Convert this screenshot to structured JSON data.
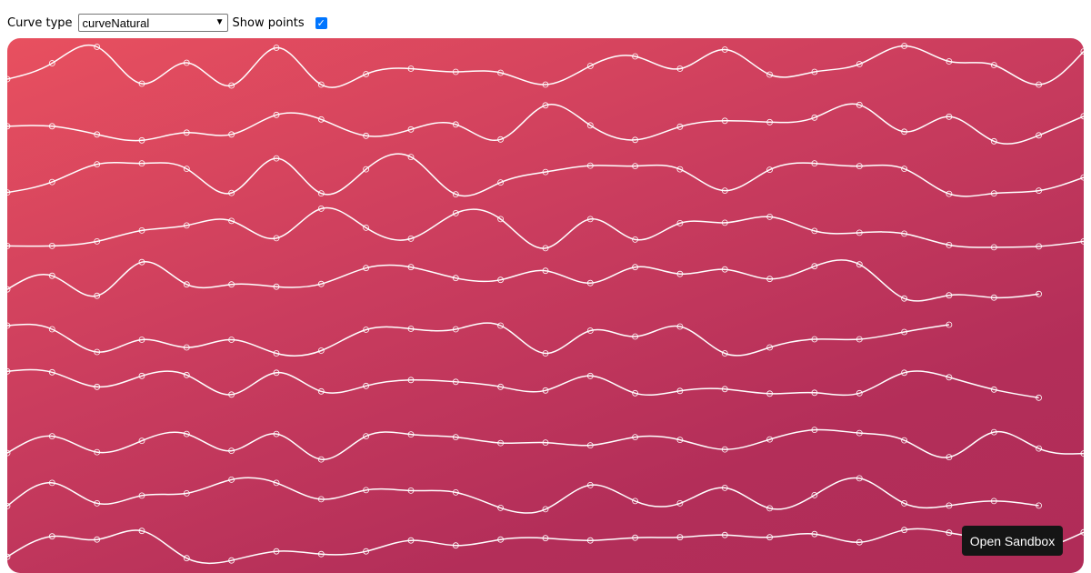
{
  "controls": {
    "curve_label": "Curve type",
    "curve_value": "curveNatural",
    "show_points_label": "Show points",
    "show_points_checked": true
  },
  "sandbox_label": "Open Sandbox",
  "colors": {
    "gradient_start": "#e8505f",
    "gradient_end": "#b02c58",
    "line": "#ffffff",
    "button_bg": "#151515"
  },
  "icons": [
    "chevron-down-icon",
    "checkmark-icon"
  ],
  "chart_data": {
    "type": "line",
    "x": [
      0,
      1,
      2,
      3,
      4,
      5,
      6,
      7,
      8,
      9,
      10,
      11,
      12,
      13,
      14,
      15,
      16,
      17,
      18,
      19,
      20,
      21,
      22,
      23,
      24
    ],
    "ylim": [
      0,
      1
    ],
    "grid": false,
    "series": [
      {
        "values": [
          0.22,
          0.57,
          0.93,
          0.12,
          0.58,
          0.08,
          0.91,
          0.1,
          0.33,
          0.45,
          0.38,
          0.36,
          0.1,
          0.51,
          0.72,
          0.45,
          0.87,
          0.32,
          0.38,
          0.55,
          0.95,
          0.61,
          0.53,
          0.1,
          0.83
        ]
      },
      {
        "values": [
          0.36,
          0.36,
          0.18,
          0.05,
          0.22,
          0.18,
          0.61,
          0.51,
          0.15,
          0.29,
          0.4,
          0.07,
          0.82,
          0.38,
          0.06,
          0.35,
          0.48,
          0.45,
          0.55,
          0.83,
          0.24,
          0.57,
          0.03,
          0.16,
          0.58
        ]
      },
      {
        "values": [
          0.08,
          0.31,
          0.7,
          0.72,
          0.6,
          0.07,
          0.83,
          0.06,
          0.59,
          0.86,
          0.04,
          0.3,
          0.53,
          0.67,
          0.66,
          0.59,
          0.12,
          0.58,
          0.72,
          0.66,
          0.6,
          0.05,
          0.06,
          0.12,
          0.41
        ]
      },
      {
        "values": [
          0.08,
          0.08,
          0.18,
          0.42,
          0.53,
          0.63,
          0.25,
          0.9,
          0.48,
          0.24,
          0.8,
          0.67,
          0.03,
          0.67,
          0.22,
          0.58,
          0.59,
          0.72,
          0.41,
          0.37,
          0.35,
          0.1,
          0.05,
          0.07,
          0.18
        ]
      },
      {
        "values": [
          0.3,
          0.6,
          0.16,
          0.9,
          0.41,
          0.41,
          0.36,
          0.42,
          0.77,
          0.79,
          0.55,
          0.51,
          0.71,
          0.44,
          0.79,
          0.64,
          0.74,
          0.53,
          0.81,
          0.85,
          0.1,
          0.17,
          0.12,
          0.2
        ]
      },
      {
        "values": [
          0.68,
          0.6,
          0.1,
          0.37,
          0.2,
          0.37,
          0.07,
          0.13,
          0.59,
          0.61,
          0.6,
          0.68,
          0.07,
          0.57,
          0.44,
          0.66,
          0.07,
          0.2,
          0.38,
          0.38,
          0.54,
          0.7
        ]
      },
      {
        "values": [
          0.85,
          0.83,
          0.51,
          0.75,
          0.77,
          0.34,
          0.82,
          0.41,
          0.53,
          0.66,
          0.62,
          0.51,
          0.43,
          0.75,
          0.37,
          0.42,
          0.46,
          0.36,
          0.38,
          0.37,
          0.82,
          0.72,
          0.45,
          0.27
        ]
      },
      {
        "values": [
          0.23,
          0.6,
          0.25,
          0.5,
          0.65,
          0.28,
          0.65,
          0.09,
          0.6,
          0.64,
          0.58,
          0.45,
          0.46,
          0.4,
          0.58,
          0.52,
          0.31,
          0.53,
          0.74,
          0.67,
          0.51,
          0.14,
          0.69,
          0.33,
          0.22
        ]
      },
      {
        "values": [
          0.24,
          0.75,
          0.3,
          0.47,
          0.52,
          0.82,
          0.75,
          0.39,
          0.59,
          0.58,
          0.54,
          0.2,
          0.17,
          0.7,
          0.35,
          0.3,
          0.64,
          0.19,
          0.48,
          0.85,
          0.3,
          0.25,
          0.35,
          0.25
        ]
      },
      {
        "values": [
          0.3,
          0.75,
          0.68,
          0.87,
          0.27,
          0.22,
          0.42,
          0.36,
          0.42,
          0.66,
          0.55,
          0.68,
          0.71,
          0.66,
          0.72,
          0.73,
          0.78,
          0.73,
          0.8,
          0.62,
          0.89,
          0.83,
          0.64,
          0.5,
          0.84
        ]
      }
    ]
  }
}
